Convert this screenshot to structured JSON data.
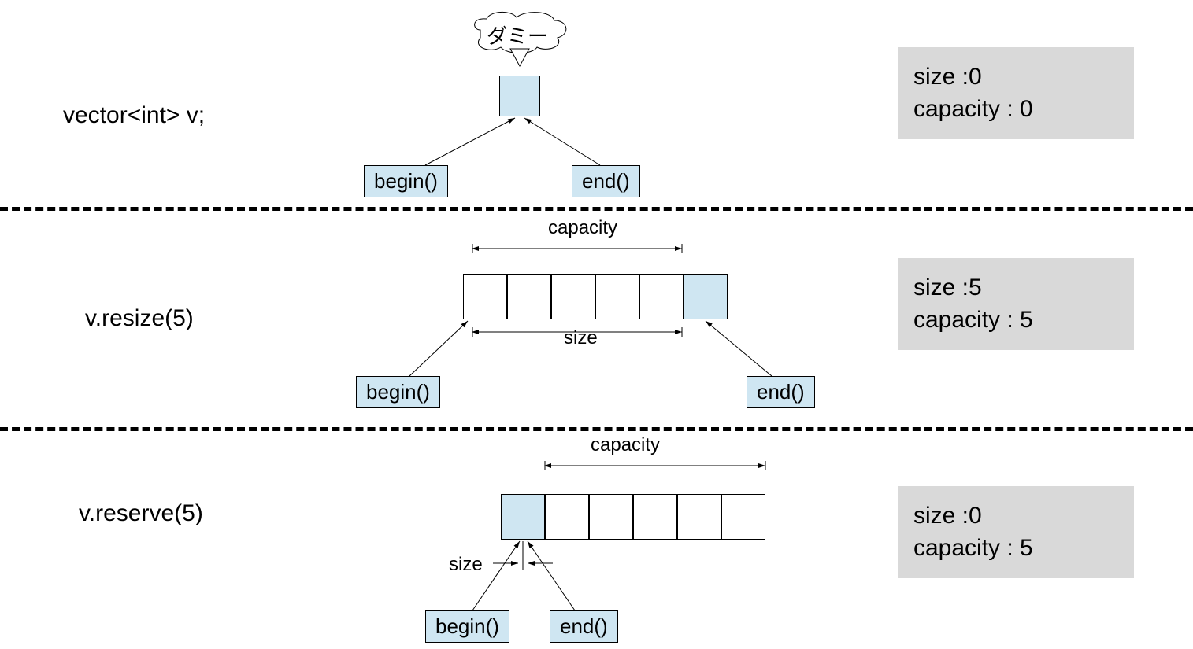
{
  "panel1": {
    "code": "vector<int> v;",
    "speech": "ダミー",
    "begin": "begin()",
    "end": "end()",
    "size_line": "size :0",
    "cap_line": "capacity : 0"
  },
  "panel2": {
    "code": "v.resize(5)",
    "capacity_label": "capacity",
    "size_label": "size",
    "begin": "begin()",
    "end": "end()",
    "size_line": "size :5",
    "cap_line": "capacity : 5"
  },
  "panel3": {
    "code": "v.reserve(5)",
    "capacity_label": "capacity",
    "size_label": "size",
    "begin": "begin()",
    "end": "end()",
    "size_line": "size :0",
    "cap_line": "capacity : 5"
  },
  "colors": {
    "cell_blue": "#cfe6f2",
    "info_gray": "#d9d9d9"
  }
}
